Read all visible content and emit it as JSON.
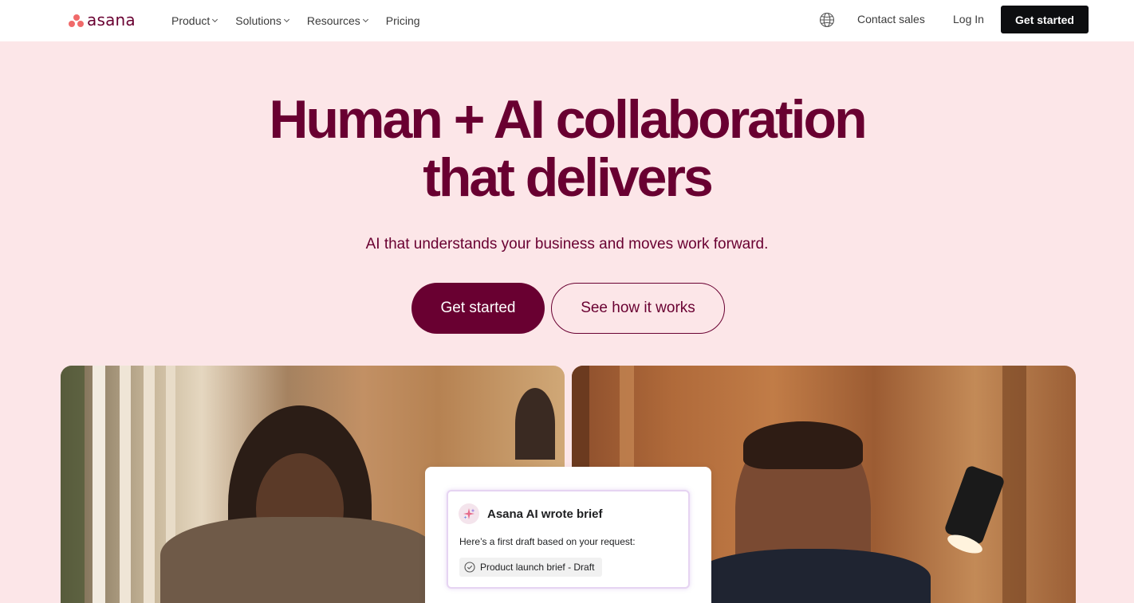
{
  "nav": {
    "logo_text": "asana",
    "menu": [
      {
        "label": "Product",
        "has_dropdown": true
      },
      {
        "label": "Solutions",
        "has_dropdown": true
      },
      {
        "label": "Resources",
        "has_dropdown": true
      },
      {
        "label": "Pricing",
        "has_dropdown": false
      }
    ],
    "globe_icon": "globe-icon",
    "contact_label": "Contact sales",
    "login_label": "Log In",
    "cta_label": "Get started"
  },
  "hero": {
    "title_line1": "Human + AI collaboration",
    "title_line2": "that delivers",
    "subtitle": "AI that understands your business and moves work forward.",
    "primary_button": "Get started",
    "secondary_button": "See how it works"
  },
  "ai_card": {
    "icon": "sparkle-icon",
    "title": "Asana AI wrote brief",
    "body": "Here’s a first draft based on your request:",
    "chip_label": "Product launch brief - Draft",
    "chip_icon": "check-circle-icon"
  },
  "colors": {
    "brand": "#690031",
    "hero_bg": "#fce6e8",
    "logo_coral": "#f06a6a",
    "nav_cta_bg": "#0d0e10"
  }
}
